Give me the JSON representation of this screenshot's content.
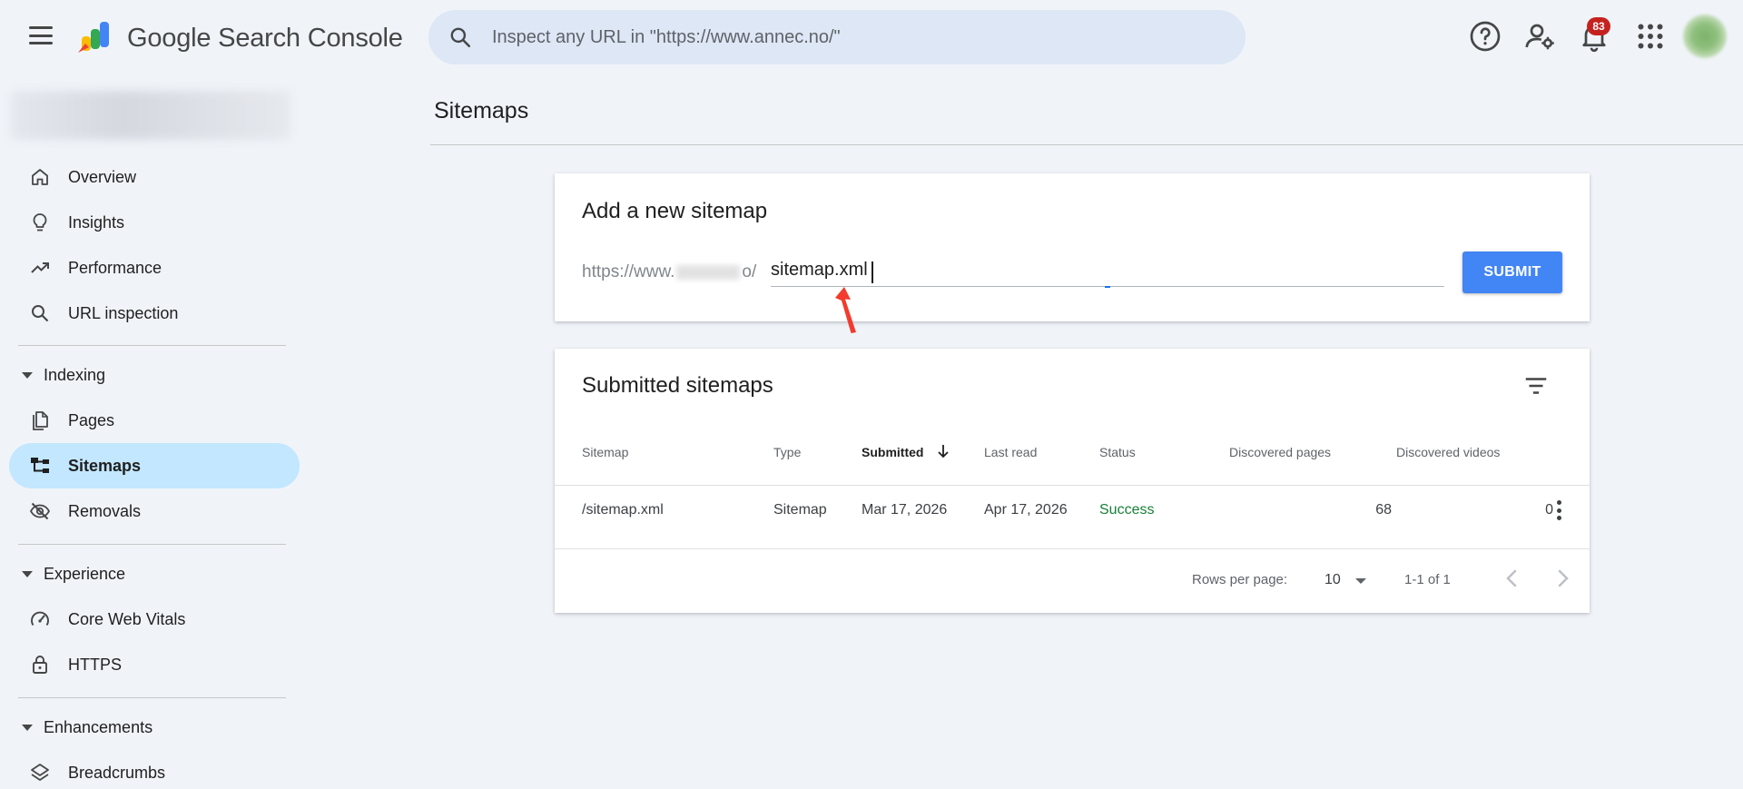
{
  "header": {
    "brand": "Google Search Console",
    "search_placeholder": "Inspect any URL in \"https://www.annec.no/\"",
    "notification_count": "83"
  },
  "sidebar": {
    "items": [
      {
        "label": "Overview",
        "icon": "home-icon"
      },
      {
        "label": "Insights",
        "icon": "lightbulb-icon"
      },
      {
        "label": "Performance",
        "icon": "trending-up-icon"
      },
      {
        "label": "URL inspection",
        "icon": "search-icon"
      }
    ],
    "indexing": {
      "label": "Indexing",
      "items": [
        {
          "label": "Pages",
          "icon": "pages-icon"
        },
        {
          "label": "Sitemaps",
          "icon": "sitemap-icon",
          "active": true
        },
        {
          "label": "Removals",
          "icon": "eye-off-icon"
        }
      ]
    },
    "experience": {
      "label": "Experience",
      "items": [
        {
          "label": "Core Web Vitals",
          "icon": "speedometer-icon"
        },
        {
          "label": "HTTPS",
          "icon": "lock-icon"
        }
      ]
    },
    "enhancements": {
      "label": "Enhancements",
      "items": [
        {
          "label": "Breadcrumbs",
          "icon": "layers-icon"
        }
      ]
    }
  },
  "main": {
    "title": "Sitemaps",
    "add_card": {
      "title": "Add a new sitemap",
      "prefix_start": "https://www.",
      "prefix_end": "o/",
      "input_value": "sitemap.xml",
      "submit_label": "SUBMIT"
    },
    "submitted_card": {
      "title": "Submitted sitemaps",
      "columns": [
        "Sitemap",
        "Type",
        "Submitted",
        "Last read",
        "Status",
        "Discovered pages",
        "Discovered videos"
      ],
      "rows": [
        {
          "sitemap": "/sitemap.xml",
          "type": "Sitemap",
          "submitted": "Mar 17, 2026",
          "last_read": "Apr 17, 2026",
          "status": "Success",
          "pages": "68",
          "videos": "0"
        }
      ],
      "rows_per_page_label": "Rows per page:",
      "rows_per_page": "10",
      "range": "1-1 of 1"
    }
  },
  "colors": {
    "accent": "#4285f4",
    "active_nav": "#c2e7ff",
    "success": "#188038",
    "background": "#f0f4f9"
  }
}
